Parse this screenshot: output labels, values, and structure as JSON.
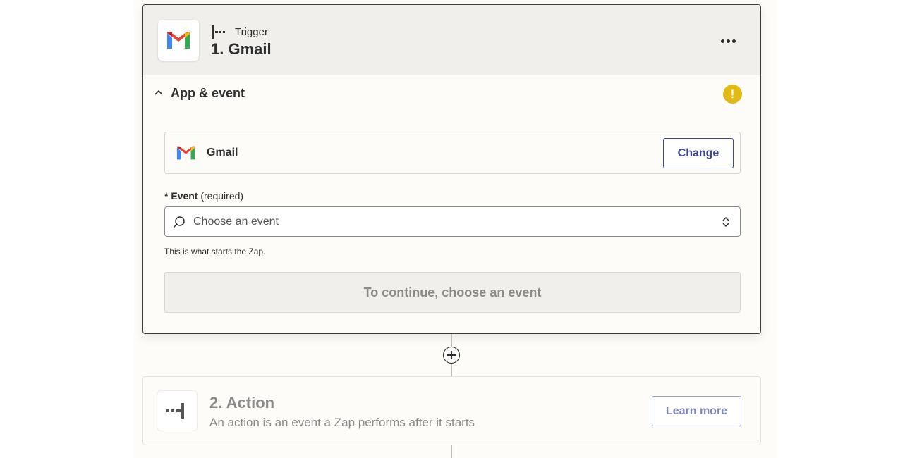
{
  "trigger": {
    "label": "Trigger",
    "title": "1. Gmail",
    "app_icon": "gmail-logo",
    "menu_icon": "more-horizontal-icon"
  },
  "app_event": {
    "section_title": "App & event",
    "warning_symbol": "!",
    "app_name": "Gmail",
    "change_label": "Change",
    "event_label_required_marker": "*",
    "event_label": "Event",
    "event_label_hint": "(required)",
    "event_placeholder": "Choose an event",
    "helper_text": "This is what starts the Zap.",
    "continue_label": "To continue, choose an event"
  },
  "action": {
    "title": "2. Action",
    "description": "An action is an event a Zap performs after it starts",
    "learn_more_label": "Learn more"
  },
  "colors": {
    "accent": "#3d4592",
    "warning": "#e3ba15",
    "muted_text": "#8a8a8a",
    "panel_bg": "#fdfcf9",
    "header_bg": "#f0efeb"
  }
}
